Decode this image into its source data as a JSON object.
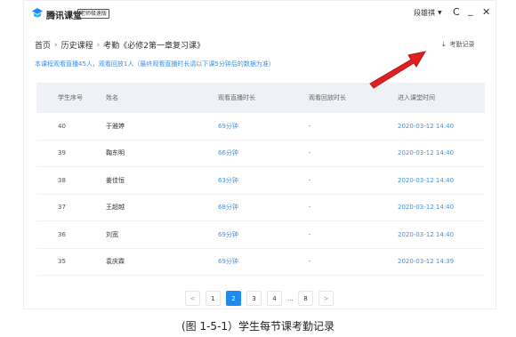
{
  "titlebar": {
    "app_name": "腾讯课堂",
    "edition": "老师极速版",
    "user": "段雄祺",
    "refresh_icon": "refresh-icon",
    "minimize_icon": "minimize-icon",
    "close_icon": "close-icon"
  },
  "breadcrumb": {
    "home": "首页",
    "course": "历史课程",
    "current": "考勤《必修2第一章复习课》"
  },
  "record_link": {
    "label": "考勤记录",
    "icon": "download-icon"
  },
  "summary": "本课程观看直播45人，观看回放1人（最终观看直播时长请以下课5分钟后的数据为准）",
  "table": {
    "headers": [
      "学生序号",
      "姓名",
      "观看直播时长",
      "观看回放时长",
      "进入课堂时间"
    ],
    "rows": [
      [
        "40",
        "于雅婷",
        "69分钟",
        "-",
        "2020-03-12 14:40"
      ],
      [
        "39",
        "鞠东明",
        "66分钟",
        "-",
        "2020-03-12 14:40"
      ],
      [
        "38",
        "姜佳恒",
        "63分钟",
        "-",
        "2020-03-12 14:40"
      ],
      [
        "37",
        "王超越",
        "68分钟",
        "-",
        "2020-03-12 14:40"
      ],
      [
        "36",
        "刘宽",
        "69分钟",
        "-",
        "2020-03-12 14:40"
      ],
      [
        "35",
        "袁庆霖",
        "69分钟",
        "-",
        "2020-03-12 14:39"
      ]
    ]
  },
  "pager": {
    "prev": "<",
    "pages": [
      "1",
      "2",
      "3",
      "4"
    ],
    "ellipsis": "...",
    "last": "8",
    "next": ">",
    "current": "2"
  },
  "caption": "(图 1-5-1）学生每节课考勤记录",
  "colors": {
    "accent": "#1f8bf0",
    "link": "#3d8ee6",
    "arrow": "#e02020"
  }
}
